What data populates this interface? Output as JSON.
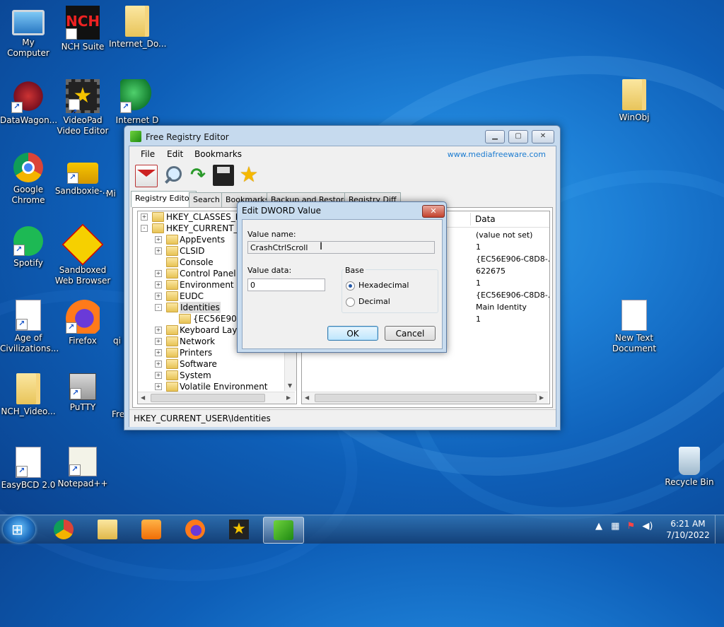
{
  "desktop": {
    "icons": [
      {
        "label": "My Computer",
        "icon": "computer-icon"
      },
      {
        "label": "NCH Suite",
        "icon": "nch-suite-icon"
      },
      {
        "label": "Internet_Do...",
        "icon": "folder-icon"
      },
      {
        "label": "DataWagon...",
        "icon": "datawagon-icon"
      },
      {
        "label": "VideoPad Video Editor",
        "icon": "videopad-icon"
      },
      {
        "label": "Internet D",
        "icon": "internet-download-manager-icon"
      },
      {
        "label": "Google Chrome",
        "icon": "chrome-icon"
      },
      {
        "label": "Sandboxie-...",
        "icon": "sandboxie-icon"
      },
      {
        "label": "Mi",
        "icon": "partial-icon"
      },
      {
        "label": "Spotify",
        "icon": "spotify-icon"
      },
      {
        "label": "Sandboxed Web Browser",
        "icon": "sandboxed-browser-icon"
      },
      {
        "label": "Age of Civilizations...",
        "icon": "document-icon"
      },
      {
        "label": "Firefox",
        "icon": "firefox-icon"
      },
      {
        "label": "qi",
        "icon": "partial-icon"
      },
      {
        "label": "NCH_Video...",
        "icon": "folder-icon"
      },
      {
        "label": "PuTTY",
        "icon": "putty-icon"
      },
      {
        "label": "Fre",
        "icon": "partial-icon"
      },
      {
        "label": "EasyBCD 2.0",
        "icon": "easybcd-icon"
      },
      {
        "label": "Notepad++",
        "icon": "notepadpp-icon"
      },
      {
        "label": "WinObj",
        "icon": "folder-icon"
      },
      {
        "label": "New Text Document",
        "icon": "text-document-icon"
      },
      {
        "label": "Recycle Bin",
        "icon": "recycle-bin-icon"
      }
    ]
  },
  "window": {
    "title": "Free Registry Editor",
    "menu": [
      "File",
      "Edit",
      "Bookmarks"
    ],
    "website": "www.mediafreeware.com",
    "toolbar_icons": [
      "mail-icon",
      "search-icon",
      "refresh-icon",
      "save-icon",
      "star-icon"
    ],
    "tabs": [
      "Registry Editor",
      "Search",
      "Bookmarks",
      "Backup and Restore",
      "Registry Diff"
    ],
    "active_tab": "Registry Editor",
    "tree": [
      {
        "label": "HKEY_CLASSES_RO",
        "expander": "+"
      },
      {
        "label": "HKEY_CURRENT_U",
        "expander": "-"
      },
      {
        "label": "AppEvents",
        "expander": "+"
      },
      {
        "label": "CLSID",
        "expander": "+"
      },
      {
        "label": "Console",
        "expander": ""
      },
      {
        "label": "Control Panel",
        "expander": "+"
      },
      {
        "label": "Environment",
        "expander": "+"
      },
      {
        "label": "EUDC",
        "expander": "+"
      },
      {
        "label": "Identities",
        "expander": "-"
      },
      {
        "label": "{EC56E906-C",
        "expander": ""
      },
      {
        "label": "Keyboard Layout",
        "expander": "+"
      },
      {
        "label": "Network",
        "expander": "+"
      },
      {
        "label": "Printers",
        "expander": "+"
      },
      {
        "label": "Software",
        "expander": "+"
      },
      {
        "label": "System",
        "expander": "+"
      },
      {
        "label": "Volatile Environment",
        "expander": "+"
      }
    ],
    "list_header": "Data",
    "list_values": [
      "(value not set)",
      "1",
      "{EC56E906-C8D8-...",
      "622675",
      "1",
      "{EC56E906-C8D8-...",
      "Main Identity",
      "1"
    ],
    "status": "HKEY_CURRENT_USER\\Identities"
  },
  "dialog": {
    "title": "Edit DWORD Value",
    "close": "✕",
    "value_name_label": "Value name:",
    "value_name": "CrashCtrlScroll",
    "value_data_label": "Value data:",
    "value_data": "0",
    "base_label": "Base",
    "hex_label": "Hexadecimal",
    "dec_label": "Decimal",
    "selected_base": "Hexadecimal",
    "ok": "OK",
    "cancel": "Cancel"
  },
  "taskbar": {
    "items": [
      "chrome-icon",
      "file-explorer-icon",
      "media-player-icon",
      "firefox-icon",
      "videopad-icon",
      "registry-editor-icon"
    ],
    "active_item": "registry-editor-icon",
    "time": "6:21 AM",
    "date": "7/10/2022"
  }
}
